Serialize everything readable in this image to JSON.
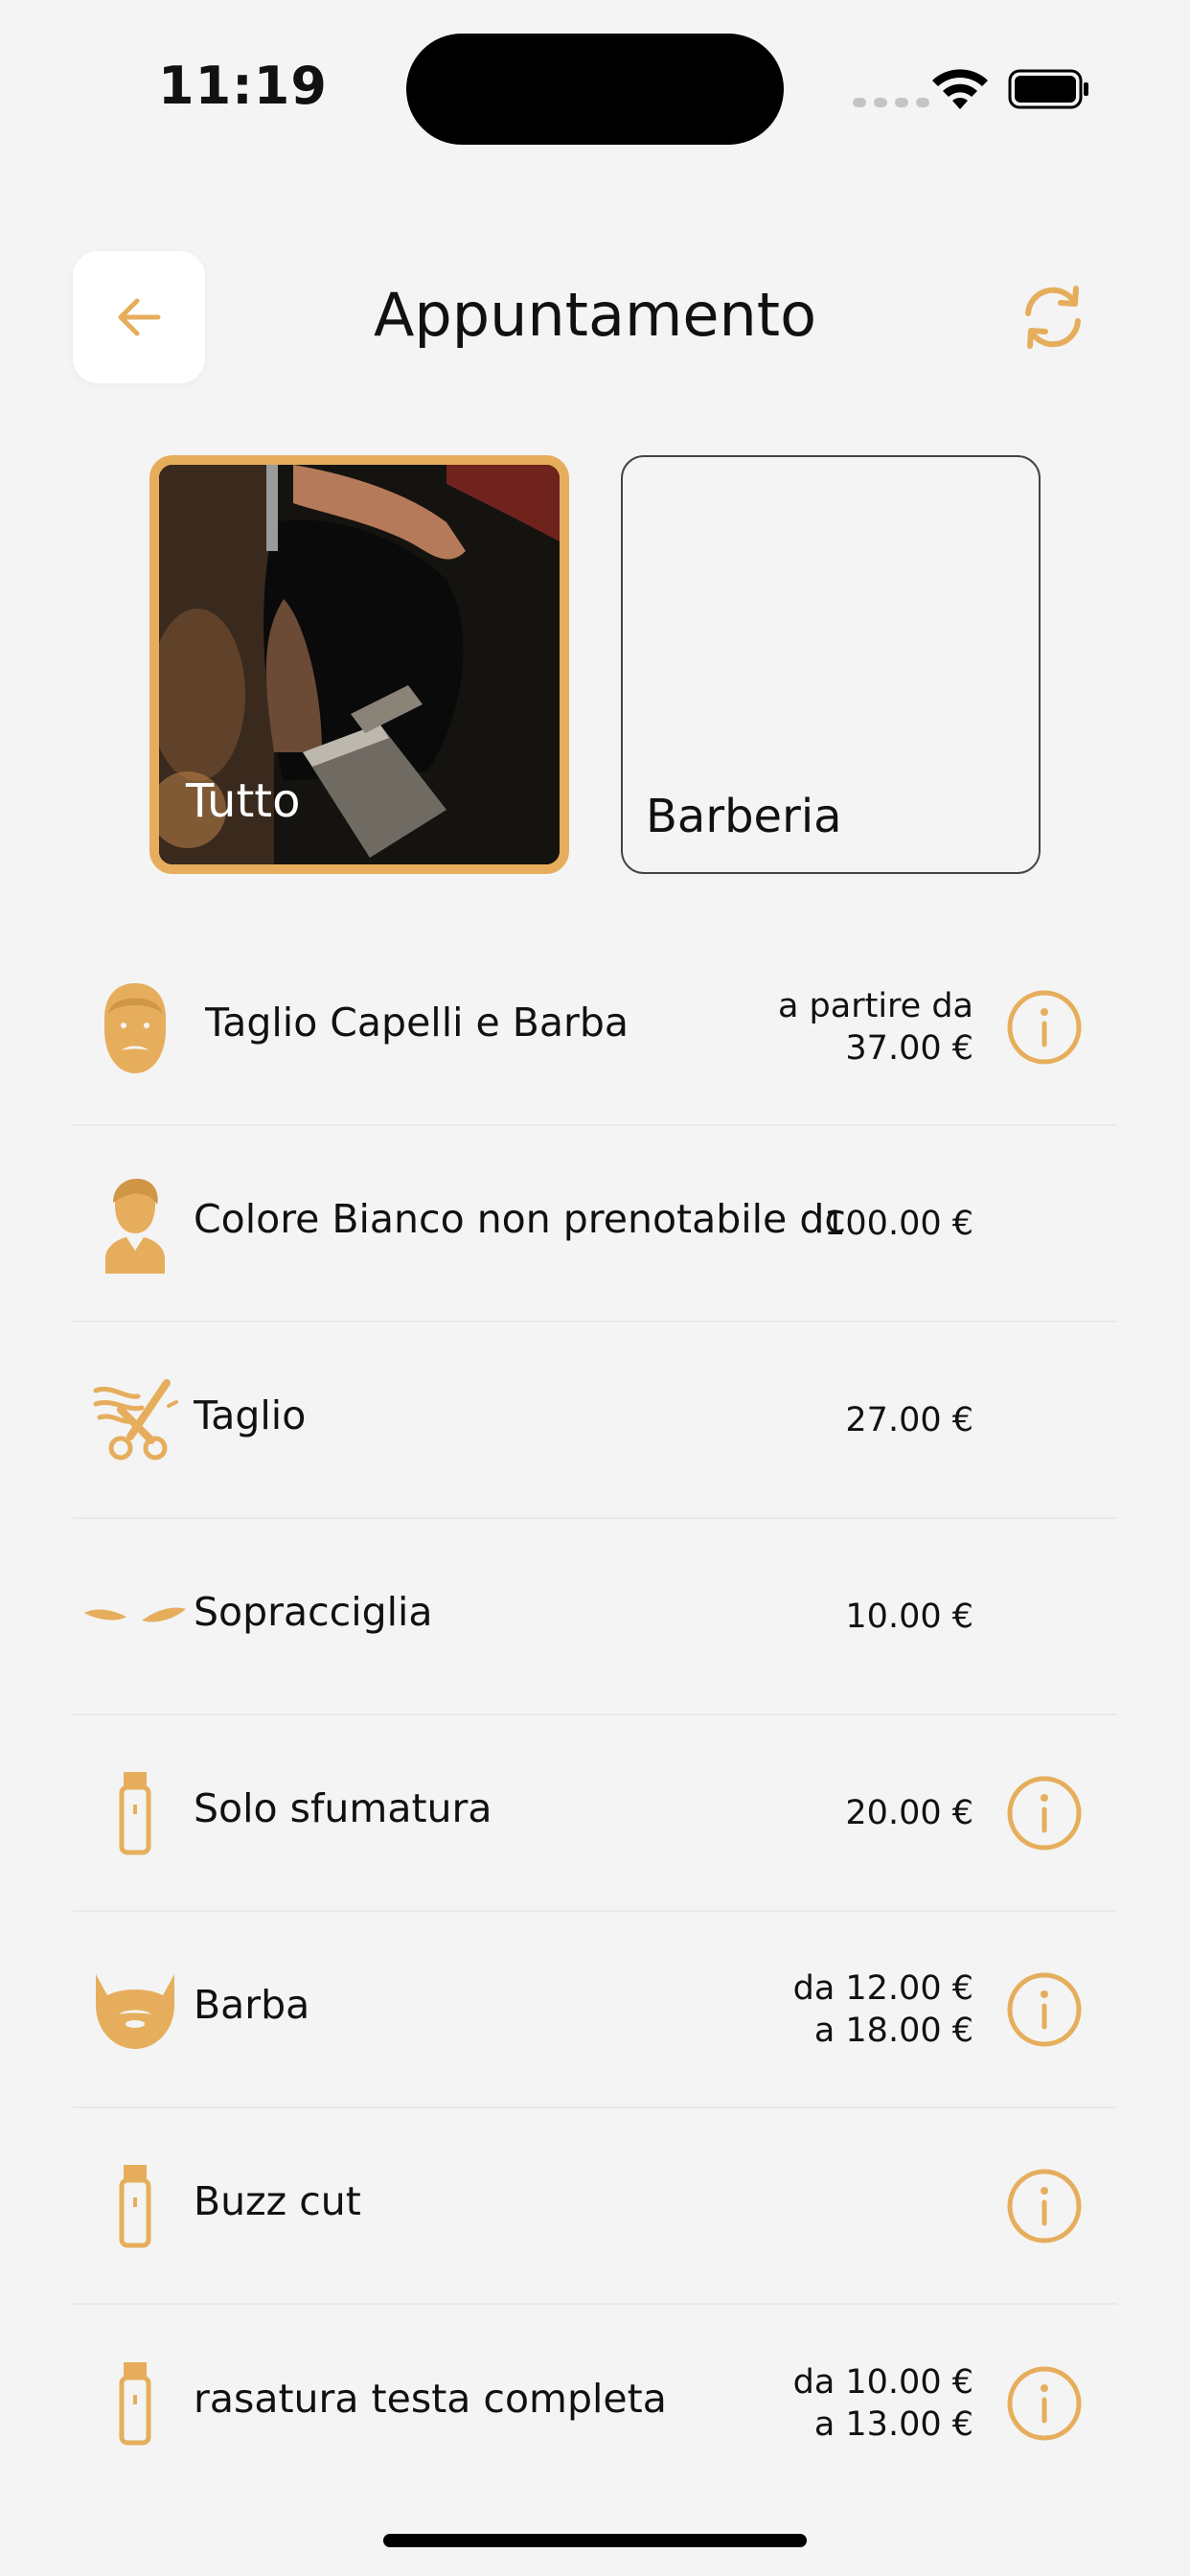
{
  "status_bar": {
    "time": "11:19"
  },
  "header": {
    "title": "Appuntamento"
  },
  "colors": {
    "accent": "#e6ae5c",
    "background": "#f4f4f4",
    "text": "#111111"
  },
  "categories": [
    {
      "label": "Tutto",
      "selected": true,
      "icon": "haircut-photo"
    },
    {
      "label": "Barberia",
      "selected": false,
      "icon": "none"
    }
  ],
  "services": [
    {
      "name": "Taglio Capelli e Barba",
      "price_line1": "a partire da",
      "price_line2": "37.00 €",
      "icon": "bearded-man-icon",
      "info": true
    },
    {
      "name": "Colore Bianco non prenotabile dc",
      "price_line1": "100.00 €",
      "price_line2": "",
      "icon": "man-bust-icon",
      "info": false
    },
    {
      "name": "Taglio",
      "price_line1": "27.00 €",
      "price_line2": "",
      "icon": "scissors-icon",
      "info": false
    },
    {
      "name": "Sopracciglia",
      "price_line1": "10.00 €",
      "price_line2": "",
      "icon": "eyebrows-icon",
      "info": false
    },
    {
      "name": "Solo sfumatura",
      "price_line1": "20.00 €",
      "price_line2": "",
      "icon": "clipper-icon",
      "info": true
    },
    {
      "name": "Barba",
      "price_line1": "da 12.00 €",
      "price_line2": "a 18.00 €",
      "icon": "beard-icon",
      "info": true
    },
    {
      "name": "Buzz cut",
      "price_line1": "",
      "price_line2": "",
      "icon": "clipper-icon",
      "info": true
    },
    {
      "name": "rasatura testa completa",
      "price_line1": "da 10.00 €",
      "price_line2": "a 13.00 €",
      "icon": "clipper-icon",
      "info": true
    }
  ]
}
